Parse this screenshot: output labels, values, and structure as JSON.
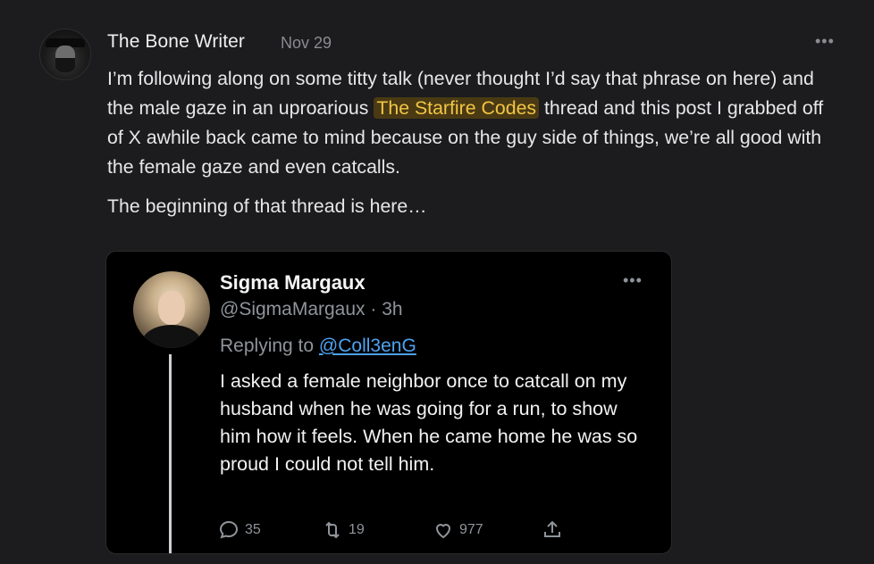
{
  "post": {
    "author": "The Bone Writer",
    "date": "Nov 29",
    "more": "•••",
    "text_before": "I’m following along on some titty talk (never thought I’d say that phrase on here) and the male gaze in an uproarious ",
    "link": "The Starfire Codes",
    "text_after": " thread and this post I grabbed off of X awhile back came to mind because on the guy side of things, we’re all good with the female gaze and even catcalls.",
    "paragraph2": "The beginning of that thread is here…",
    "highlight_color": "#f2c544"
  },
  "tweet": {
    "name": "Sigma Margaux",
    "handle": "@SigmaMargaux · 3h",
    "more": "•••",
    "replying_prefix": "Replying to ",
    "replying_to": "@Coll3enG",
    "text": "I asked a female neighbor once to catcall on my husband when he was going for a run, to show him how it feels. When he came home he was so proud I could not tell him.",
    "replies": "35",
    "retweets": "19",
    "likes": "977",
    "icons": [
      "reply-icon",
      "retweet-icon",
      "like-icon",
      "share-icon"
    ]
  }
}
